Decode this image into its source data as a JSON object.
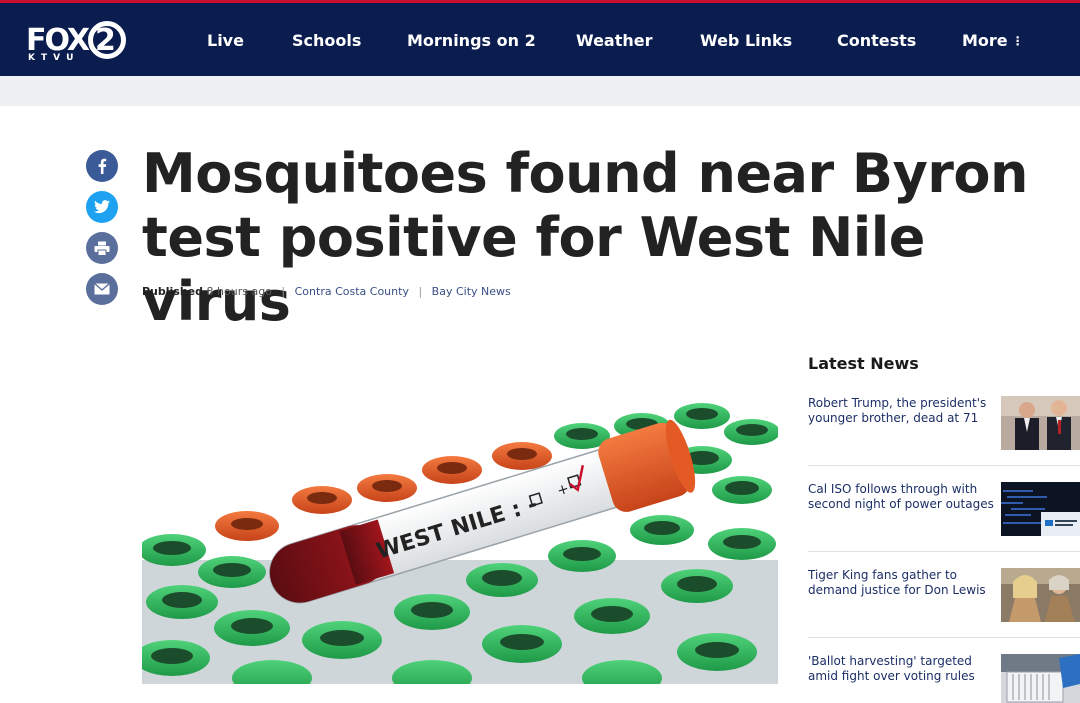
{
  "brand": {
    "logo_main": "FOX",
    "logo_number": "2",
    "logo_sub": "KTVU"
  },
  "nav": {
    "items": [
      "Live",
      "Schools",
      "Mornings on 2",
      "Weather",
      "Web Links",
      "Contests"
    ],
    "more_label": "More",
    "more_icon": "⋮"
  },
  "colors": {
    "nav_bg": "#0b1d4f",
    "accent_red": "#c8102e",
    "link_blue": "#1c2f66",
    "facebook": "#3b5a98",
    "twitter": "#1ea1f1"
  },
  "share": {
    "icons": [
      "facebook-icon",
      "twitter-icon",
      "print-icon",
      "email-icon"
    ]
  },
  "article": {
    "headline": "Mosquitoes found near Byron test positive for West Nile virus",
    "published_label": "Published",
    "published_time": "8 hours ago",
    "category": "Contra Costa County",
    "source": "Bay City News",
    "image_label_text": "WEST NILE : -",
    "image_check": "+"
  },
  "sidebar": {
    "title": "Latest News",
    "items": [
      {
        "headline": "Robert Trump, the president's younger brother, dead at 71"
      },
      {
        "headline": "Cal ISO follows through with second night of power outages"
      },
      {
        "headline": "Tiger King fans gather to demand justice for Don Lewis"
      },
      {
        "headline": "'Ballot harvesting' targeted amid fight over voting rules"
      }
    ]
  }
}
